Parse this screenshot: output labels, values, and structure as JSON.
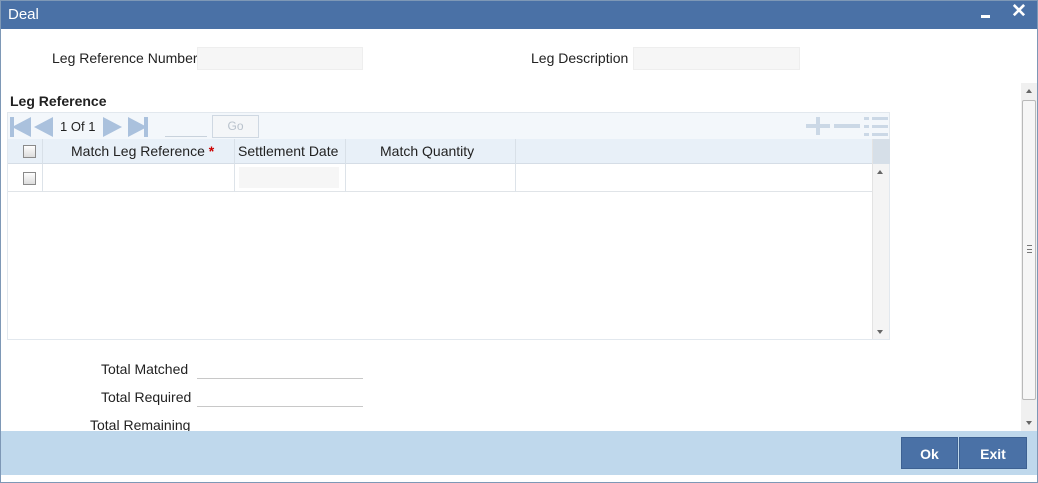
{
  "window": {
    "title": "Deal",
    "minimize_glyph": "_",
    "close_glyph": "✕"
  },
  "header_fields": {
    "leg_reference_number_label": "Leg Reference Number",
    "leg_reference_number_value": "",
    "leg_description_label": "Leg Description",
    "leg_description_value": ""
  },
  "leg_reference": {
    "section_title": "Leg Reference",
    "pagination": {
      "current": "1",
      "of_label": "Of",
      "total": "1",
      "go_label": "Go",
      "page_input": ""
    },
    "columns": [
      {
        "label": "Match Leg Reference",
        "required": "*"
      },
      {
        "label": "Settlement Date"
      },
      {
        "label": "Match Quantity"
      }
    ],
    "rows": [
      {
        "match_leg_reference": "",
        "settlement_date": "",
        "match_quantity": ""
      }
    ]
  },
  "totals": {
    "total_matched_label": "Total Matched",
    "total_matched_value": "",
    "total_required_label": "Total Required",
    "total_required_value": "",
    "total_remaining_label": "Total Remaining"
  },
  "footer": {
    "ok_label": "Ok",
    "exit_label": "Exit"
  },
  "icons": [
    "first-page-icon",
    "prev-page-icon",
    "next-page-icon",
    "last-page-icon",
    "add-row-icon",
    "delete-row-icon",
    "single-view-icon"
  ],
  "colors": {
    "titlebar": "#4a71a6",
    "footer": "#bfd8ec",
    "button": "#4a71a6",
    "required": "#cc0000",
    "nav_icon": "#aac1dd"
  }
}
